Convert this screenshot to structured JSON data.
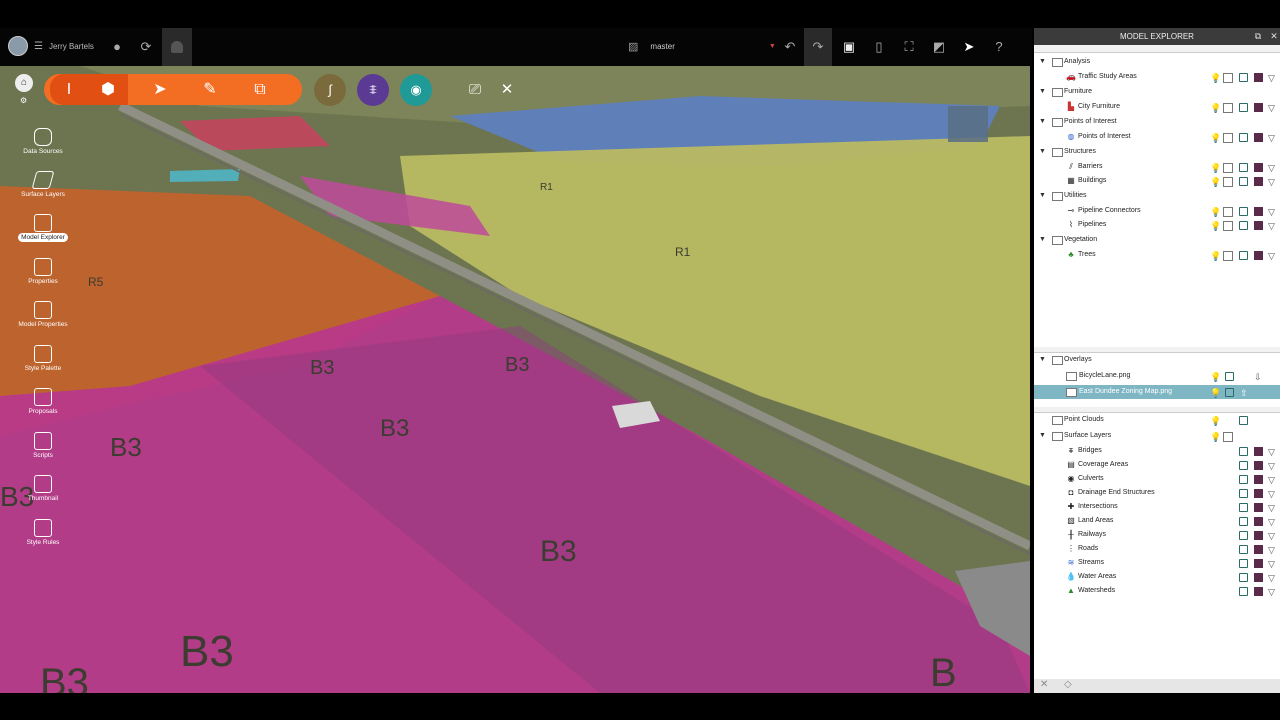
{
  "user": {
    "name": "Jerry Bartels"
  },
  "topbar": {
    "branch": "master"
  },
  "rail": {
    "items": [
      {
        "label": "Data Sources"
      },
      {
        "label": "Surface Layers"
      },
      {
        "label": "Model Explorer"
      },
      {
        "label": "Properties"
      },
      {
        "label": "Model Properties"
      },
      {
        "label": "Style Palette"
      },
      {
        "label": "Proposals"
      },
      {
        "label": "Scripts"
      },
      {
        "label": "Thumbnail"
      },
      {
        "label": "Style Rules"
      }
    ]
  },
  "map": {
    "zone_labels": [
      "R1",
      "R1",
      "R5",
      "B3",
      "B3",
      "B3",
      "B3",
      "B3",
      "B3",
      "B3",
      "B3",
      "B"
    ],
    "colors": {
      "business": "#c0398f",
      "residential": "#c5c56a",
      "orange": "#c2622c",
      "water": "#5f7fb8"
    }
  },
  "explorer": {
    "title": "MODEL EXPLORER",
    "tree": [
      {
        "group": "Analysis",
        "children": [
          "Traffic Study Areas"
        ]
      },
      {
        "group": "Furniture",
        "children": [
          "City Furniture"
        ]
      },
      {
        "group": "Points of Interest",
        "children": [
          "Points of Interest"
        ]
      },
      {
        "group": "Structures",
        "children": [
          "Barriers",
          "Buildings"
        ]
      },
      {
        "group": "Utilities",
        "children": [
          "Pipeline Connectors",
          "Pipelines"
        ]
      },
      {
        "group": "Vegetation",
        "children": [
          "Trees"
        ]
      }
    ],
    "overlays": {
      "group": "Overlays",
      "items": [
        "BicycleLane.png",
        "East Dundee Zoning Map.png"
      ]
    },
    "point_clouds": "Point Clouds",
    "surface_layers": {
      "group": "Surface Layers",
      "items": [
        "Bridges",
        "Coverage Areas",
        "Culverts",
        "Drainage End Structures",
        "Intersections",
        "Land Areas",
        "Railways",
        "Roads",
        "Streams",
        "Water Areas",
        "Watersheds"
      ]
    }
  }
}
